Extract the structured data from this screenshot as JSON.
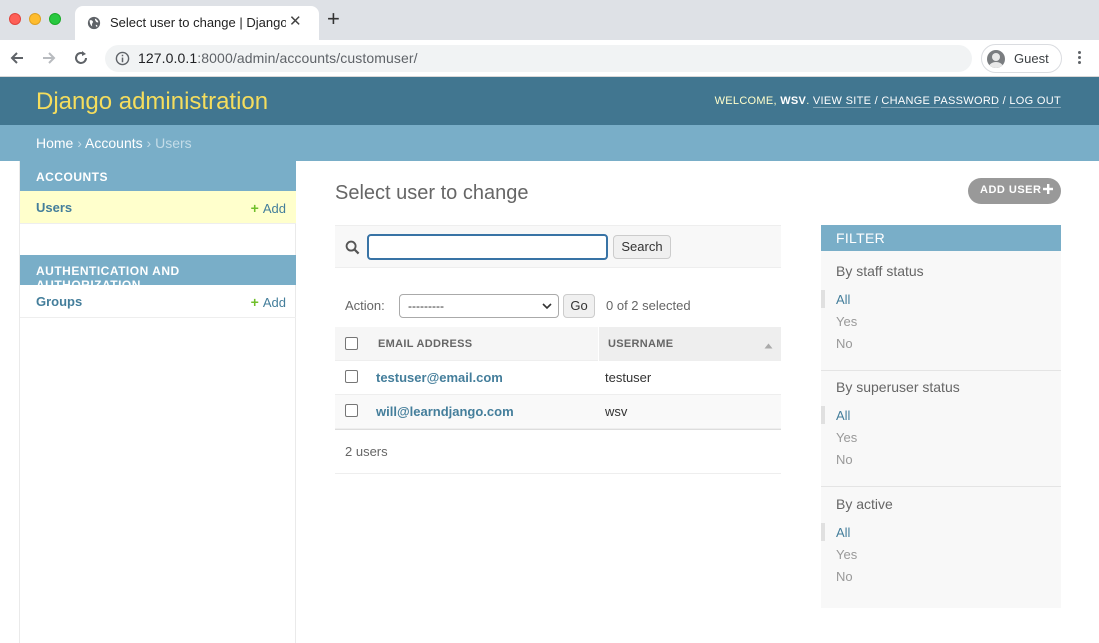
{
  "browser": {
    "tab_title": "Select user to change | Django",
    "url_host": "127.0.0.1",
    "url_rest": ":8000/admin/accounts/customuser/",
    "profile_name": "Guest"
  },
  "header": {
    "branding": "Django administration",
    "welcome": "WELCOME,",
    "username": "WSV",
    "view_site": "VIEW SITE",
    "change_password": "CHANGE PASSWORD",
    "log_out": "LOG OUT",
    "separator": "/"
  },
  "breadcrumbs": {
    "home": "Home",
    "app": "Accounts",
    "current": "Users",
    "sep": "›"
  },
  "sidebar": {
    "modules": [
      {
        "caption": "ACCOUNTS",
        "items": [
          {
            "label": "Users",
            "add": "Add"
          }
        ]
      },
      {
        "caption": "AUTHENTICATION AND AUTHORIZATION",
        "items": [
          {
            "label": "Groups",
            "add": "Add"
          }
        ]
      }
    ]
  },
  "content": {
    "title": "Select user to change",
    "add_button": "ADD USER",
    "search_value": "",
    "search_button": "Search",
    "action_label": "Action:",
    "action_selected": "---------",
    "go_button": "Go",
    "selected_count": "0 of 2 selected",
    "columns": [
      "EMAIL ADDRESS",
      "USERNAME"
    ],
    "rows": [
      {
        "email": "testuser@email.com",
        "username": "testuser"
      },
      {
        "email": "will@learndjango.com",
        "username": "wsv"
      }
    ],
    "result_count": "2 users"
  },
  "filter": {
    "heading": "FILTER",
    "groups": [
      {
        "title": "By staff status",
        "options": [
          "All",
          "Yes",
          "No"
        ],
        "selected": "All"
      },
      {
        "title": "By superuser status",
        "options": [
          "All",
          "Yes",
          "No"
        ],
        "selected": "All"
      },
      {
        "title": "By active",
        "options": [
          "All",
          "Yes",
          "No"
        ],
        "selected": "All"
      }
    ]
  },
  "colors": {
    "header_bg": "#417690",
    "breadcrumb_bg": "#79aec8",
    "branding": "#f5dd5d",
    "link": "#447e9b",
    "add_green": "#70bf2b",
    "current_row": "#ffffcc"
  }
}
